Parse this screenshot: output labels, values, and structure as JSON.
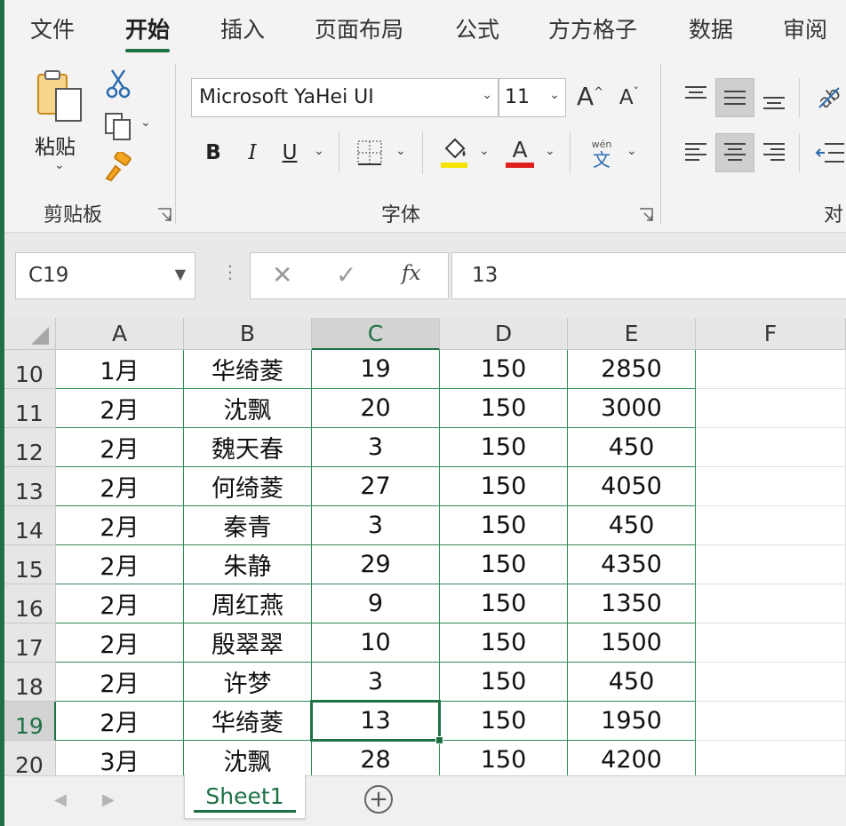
{
  "colors": {
    "accent": "#1e7145",
    "font_color_red": "#e02020",
    "highlight_yellow": "#f5e300"
  },
  "menu": {
    "tabs": [
      {
        "label": "文件"
      },
      {
        "label": "开始",
        "active": true
      },
      {
        "label": "插入"
      },
      {
        "label": "页面布局"
      },
      {
        "label": "公式"
      },
      {
        "label": "方方格子"
      },
      {
        "label": "数据"
      },
      {
        "label": "审阅"
      }
    ]
  },
  "ribbon": {
    "clipboard": {
      "paste_label": "粘贴",
      "group_label": "剪贴板"
    },
    "font": {
      "font_name": "Microsoft YaHei UI",
      "font_size": "11",
      "bold": "B",
      "italic": "I",
      "underline": "U",
      "font_color_glyph": "A",
      "phonetic_top": "wén",
      "phonetic_bottom": "文",
      "group_label": "字体"
    },
    "alignment": {
      "group_label_partial": "对"
    }
  },
  "formula_bar": {
    "name_box": "C19",
    "fx": "fx",
    "formula": "13"
  },
  "sheet": {
    "columns": [
      "A",
      "B",
      "C",
      "D",
      "E",
      "F"
    ],
    "selected_column": "C",
    "selected_row": "19",
    "rows": [
      {
        "num": "10",
        "cells": [
          "1月",
          "华绮菱",
          "19",
          "150",
          "2850"
        ]
      },
      {
        "num": "11",
        "cells": [
          "2月",
          "沈飘",
          "20",
          "150",
          "3000"
        ]
      },
      {
        "num": "12",
        "cells": [
          "2月",
          "魏天春",
          "3",
          "150",
          "450"
        ]
      },
      {
        "num": "13",
        "cells": [
          "2月",
          "何绮菱",
          "27",
          "150",
          "4050"
        ]
      },
      {
        "num": "14",
        "cells": [
          "2月",
          "秦青",
          "3",
          "150",
          "450"
        ]
      },
      {
        "num": "15",
        "cells": [
          "2月",
          "朱静",
          "29",
          "150",
          "4350"
        ]
      },
      {
        "num": "16",
        "cells": [
          "2月",
          "周红燕",
          "9",
          "150",
          "1350"
        ]
      },
      {
        "num": "17",
        "cells": [
          "2月",
          "殷翠翠",
          "10",
          "150",
          "1500"
        ]
      },
      {
        "num": "18",
        "cells": [
          "2月",
          "许梦",
          "3",
          "150",
          "450"
        ]
      },
      {
        "num": "19",
        "cells": [
          "2月",
          "华绮菱",
          "13",
          "150",
          "1950"
        ]
      },
      {
        "num": "20",
        "cells": [
          "3月",
          "沈飘",
          "28",
          "150",
          "4200"
        ]
      }
    ]
  },
  "sheet_tabs": {
    "tabs": [
      "Sheet1"
    ],
    "add_glyph": "+"
  }
}
